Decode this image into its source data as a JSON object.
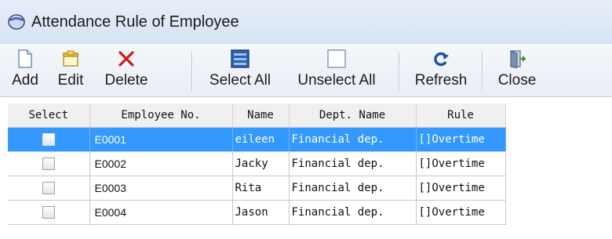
{
  "window": {
    "title": "Attendance Rule of Employee",
    "icon": "app-window-icon"
  },
  "toolbar": {
    "buttons": [
      {
        "label": "Add",
        "icon": "add-page-icon"
      },
      {
        "label": "Edit",
        "icon": "edit-folder-icon"
      },
      {
        "label": "Delete",
        "icon": "delete-x-icon"
      },
      {
        "label": "Select All",
        "icon": "select-all-icon"
      },
      {
        "label": "Unselect All",
        "icon": "unselect-all-icon"
      },
      {
        "label": "Refresh",
        "icon": "refresh-icon"
      },
      {
        "label": "Close",
        "icon": "close-door-icon"
      }
    ]
  },
  "grid": {
    "columns": [
      "Select",
      "Employee No.",
      "Name",
      "Dept. Name",
      "Rule"
    ],
    "rows": [
      {
        "employee_no": "E0001",
        "name": "eileen",
        "dept": "Financial dep.",
        "rule": "[]Overtime",
        "selected": true
      },
      {
        "employee_no": "E0002",
        "name": "Jacky",
        "dept": "Financial dep.",
        "rule": "[]Overtime",
        "selected": false
      },
      {
        "employee_no": "E0003",
        "name": "Rita",
        "dept": "Financial dep.",
        "rule": "[]Overtime",
        "selected": false
      },
      {
        "employee_no": "E0004",
        "name": "Jason",
        "dept": "Financial dep.",
        "rule": "[]Overtime",
        "selected": false
      }
    ]
  },
  "colors": {
    "selection": "#3399ff",
    "titlebar": "#d7e3f3",
    "delete_icon": "#d11a1a",
    "refresh_icon": "#1e4fa8"
  }
}
